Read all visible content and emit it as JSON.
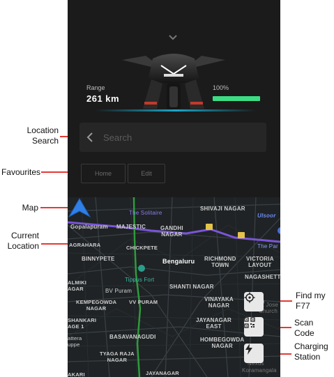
{
  "annotations": {
    "location_search": "Location\nSearch",
    "favourites": "Favourites",
    "map": "Map",
    "current_location": "Current\nLocation",
    "find_my": "Find my\nF77",
    "scan_code": "Scan\nCode",
    "charging_station": "Charging\nStation"
  },
  "vehicle": {
    "range_label": "Range",
    "range_value": "261 km",
    "battery_label": "100%",
    "battery_fraction": 1.0
  },
  "search": {
    "placeholder": "Search"
  },
  "favourites": {
    "home": "Home",
    "edit": "Edit"
  },
  "map": {
    "labels": {
      "solitaire": "The Solitaire",
      "shivaji": "SHIVAJI NAGAR",
      "ulsoor": "Ulsoor",
      "gopalapuram": "Gopalapuram",
      "majestic": "MAJESTIC",
      "gandhi": "GANDHI\nNAGAR",
      "agrahara": "AGRAHARA",
      "chickpete": "CHICKPETE",
      "thepar": "The Par",
      "binnypete": "BINNYPETE",
      "bengaluru": "Bengaluru",
      "richmond": "RICHMOND\nTOWN",
      "victoria": "VICTORIA\nLAYOUT",
      "tippus": "Tippus Fort",
      "nagashett": "NAGASHETT",
      "almiki": "ALMIKI\nAGAR",
      "shanti": "SHANTI NAGAR",
      "bvpuram": "BV Puram",
      "kempegowda": "KEMPEGOWDA\nNAGAR",
      "vvpuram": "VV PURAM",
      "vinayaka": "VINAYAKA\nNAGAR",
      "stjoseph": "St Jose\nChurch",
      "shankari": "SHANKARI\nAGE 1",
      "jayanagar_east": "JAYANAGAR\nEAST",
      "attera": "attera\nuppe",
      "basavanagudi": "BASAVANAGUDI",
      "hombegowda": "HOMBEGOWDA\nNAGAR",
      "tyagaraja": "TYAGA RAJA\nNAGAR",
      "nexus": "Nexus",
      "koramangala": "Koramangala",
      "jayanagar": "JAYANAGAR",
      "akari": "AKARI"
    },
    "route_marker_1": "1",
    "route_marker_2": "5"
  },
  "map_buttons": {
    "find_icon": "crosshair-icon",
    "scan_icon": "qr-code-icon",
    "charge_icon": "lightning-icon"
  },
  "colors": {
    "battery_green": "#3ddc84",
    "annotation_red": "#e53935",
    "metro_purple": "#7a55d6",
    "metro_green": "#2e9c3c",
    "location_blue": "#2f7fe6"
  }
}
